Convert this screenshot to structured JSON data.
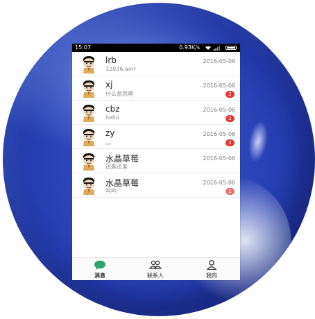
{
  "status_bar": {
    "time": "15:07",
    "speed": "0.93K/s",
    "icons": [
      "wifi-icon",
      "signal-icon",
      "battery-icon"
    ]
  },
  "conversations": [
    {
      "name": "lrb",
      "message": "12036.amr",
      "date": "2016-05-06",
      "unread": ""
    },
    {
      "name": "xj",
      "message": "什么意思啊",
      "date": "2016-05-06",
      "unread": "2"
    },
    {
      "name": "cbz",
      "message": "hello",
      "date": "2016-05-06",
      "unread": "2"
    },
    {
      "name": "zy",
      "message": "。。",
      "date": "2016-05-06",
      "unread": "2"
    },
    {
      "name": "水晶草莓",
      "message": "还差还差",
      "date": "2016-05-06",
      "unread": ""
    },
    {
      "name": "水晶草莓",
      "message": "呜呜",
      "date": "2016-05-06",
      "unread": "1"
    }
  ],
  "tabs": [
    {
      "label": "消息",
      "icon": "chat-bubble-icon",
      "active": true
    },
    {
      "label": "联系人",
      "icon": "contacts-icon",
      "active": false
    },
    {
      "label": "我的",
      "icon": "person-icon",
      "active": false
    }
  ],
  "colors": {
    "accent": "#2fa36b",
    "badge": "#e53935",
    "sphere": "#2a44b8"
  }
}
